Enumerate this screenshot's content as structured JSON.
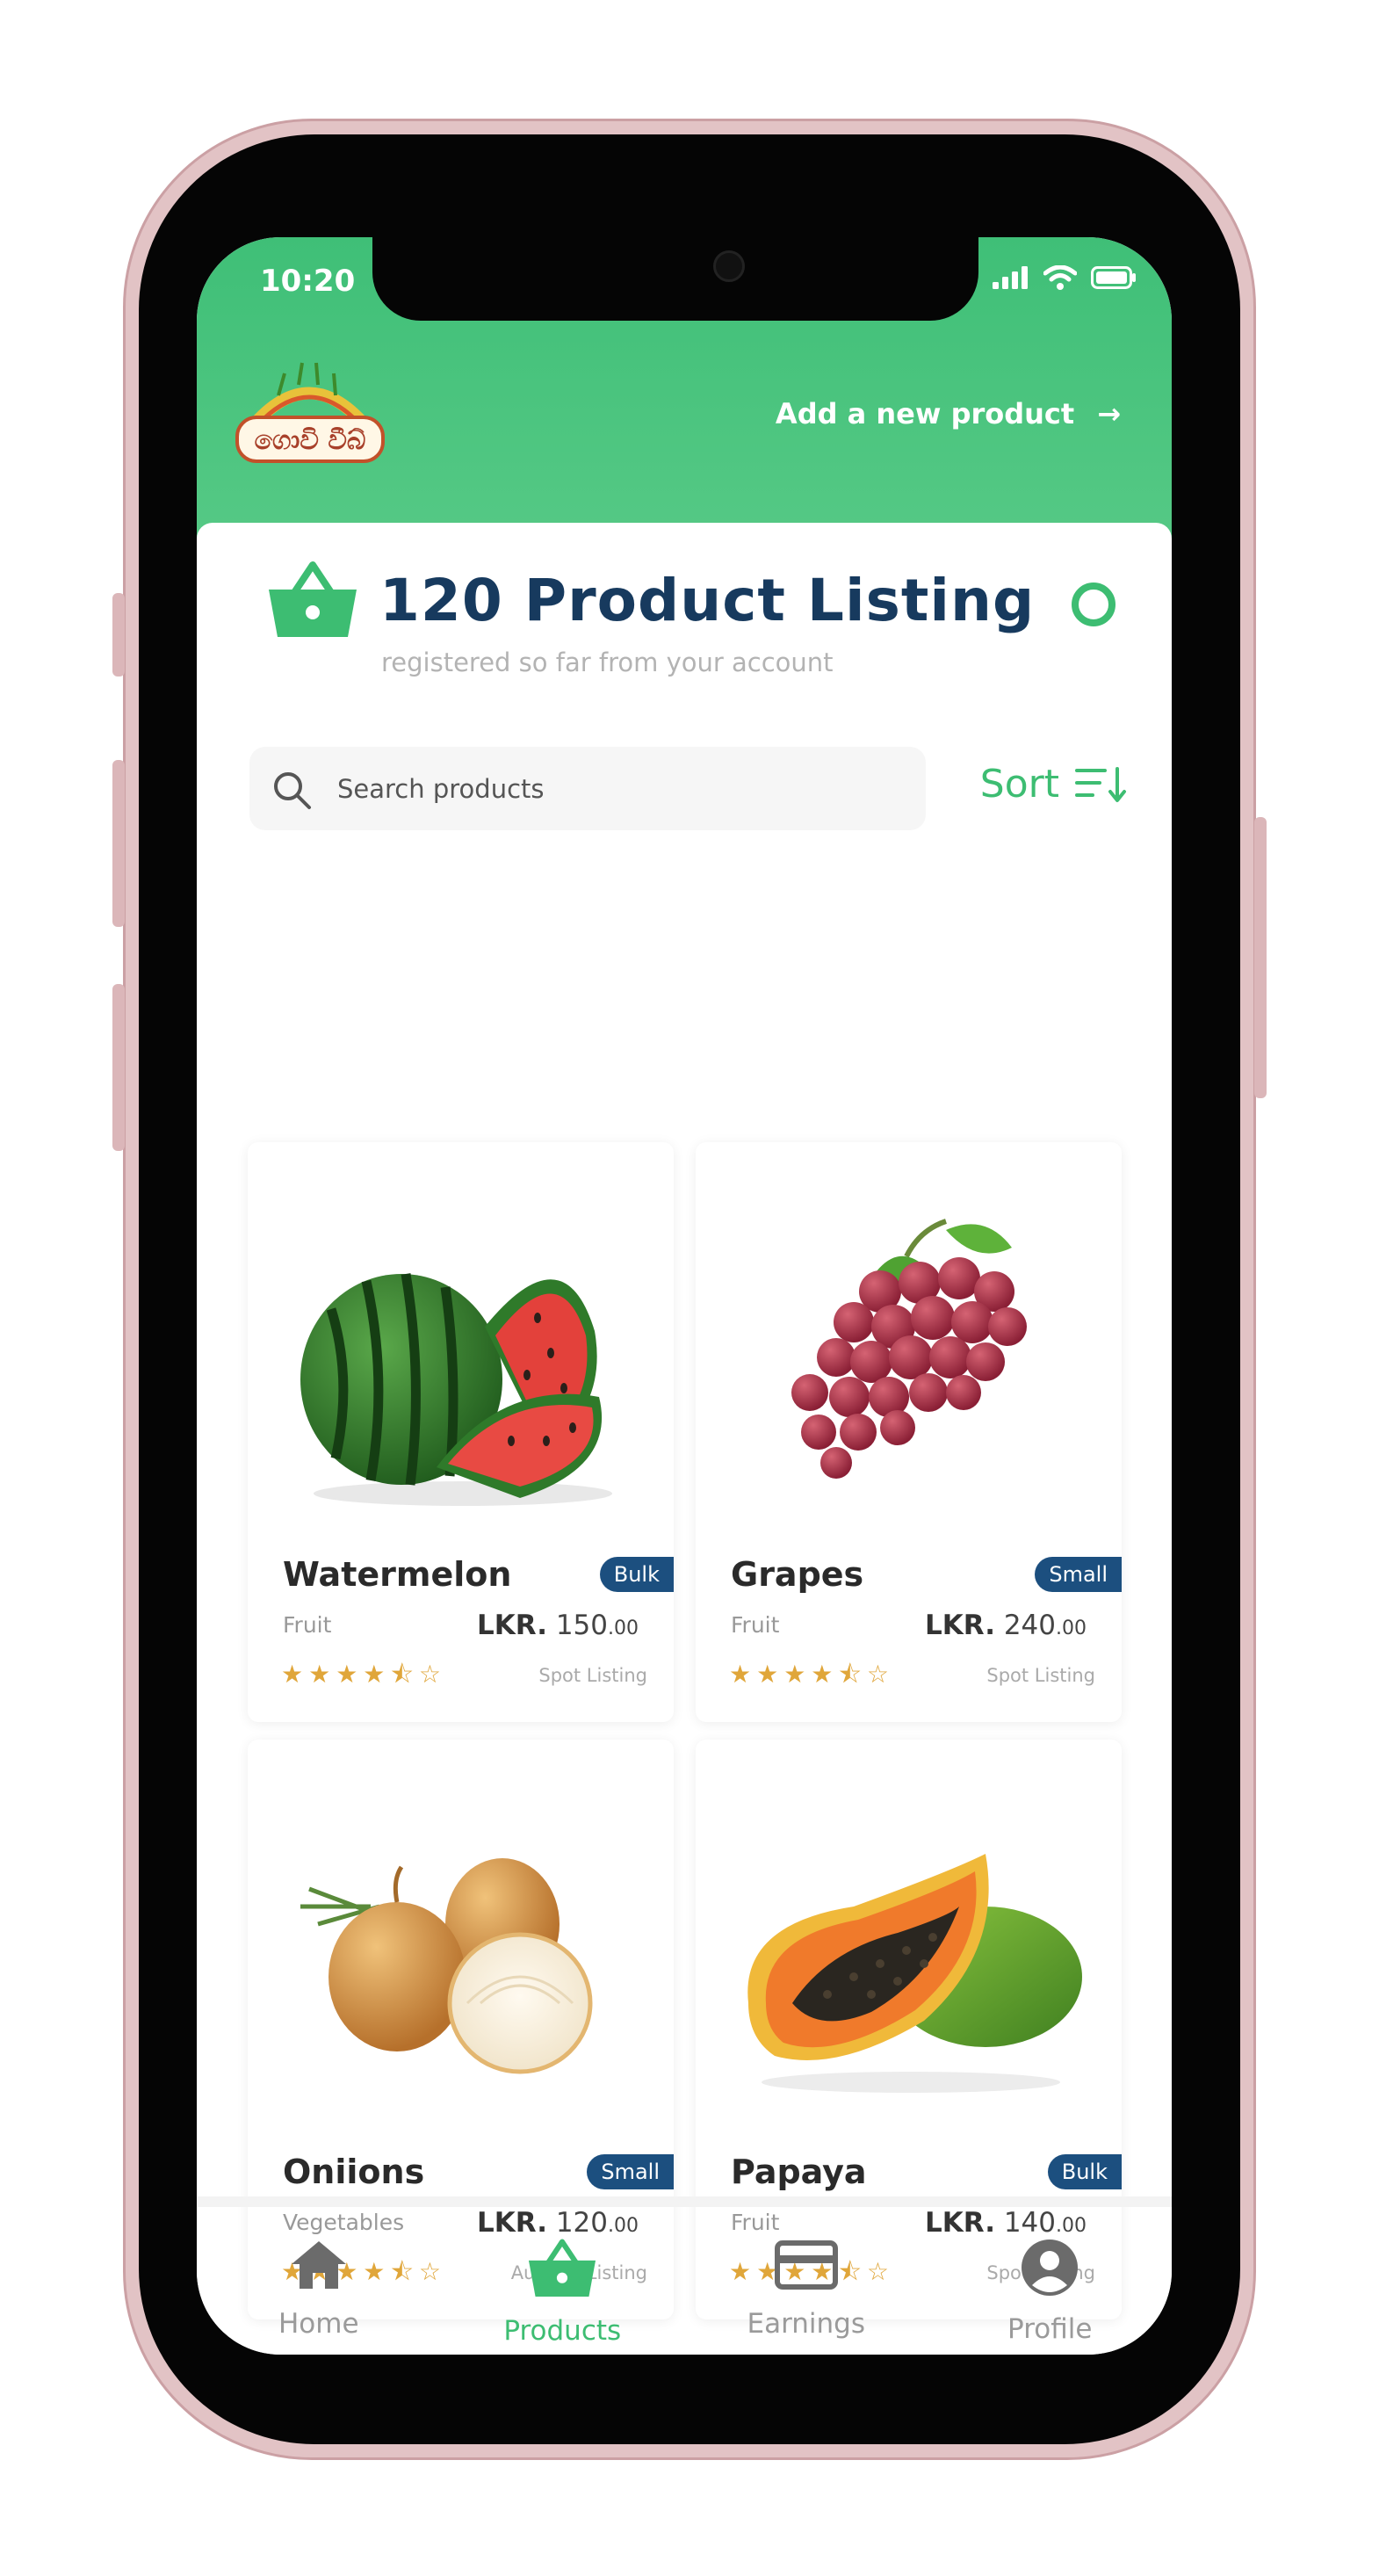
{
  "status_bar": {
    "time": "10:20"
  },
  "header": {
    "logo_text": "ගොවි වීබ්",
    "add_product_label": "Add a new product",
    "add_product_arrow": "→"
  },
  "summary": {
    "title": "120 Product Listing",
    "subtitle": "registered so far from your account"
  },
  "search": {
    "placeholder": "Search products"
  },
  "sort": {
    "label": "Sort"
  },
  "products": [
    {
      "name": "Watermelon",
      "badge": "Bulk",
      "category": "Fruit",
      "currency": "LKR.",
      "price": "150",
      "cents": ".00",
      "rating": 4.5,
      "listing_type": "Spot Listing"
    },
    {
      "name": "Grapes",
      "badge": "Small",
      "category": "Fruit",
      "currency": "LKR.",
      "price": "240",
      "cents": ".00",
      "rating": 4.5,
      "listing_type": "Spot Listing"
    },
    {
      "name": "Oniions",
      "badge": "Small",
      "category": "Vegetables",
      "currency": "LKR.",
      "price": "120",
      "cents": ".00",
      "rating": 4.5,
      "listing_type": "Auction Listing"
    },
    {
      "name": "Papaya",
      "badge": "Bulk",
      "category": "Fruit",
      "currency": "LKR.",
      "price": "140",
      "cents": ".00",
      "rating": 4.5,
      "listing_type": "Spot Listing"
    }
  ],
  "nav": {
    "items": [
      {
        "label": "Home",
        "icon": "home-icon",
        "active": false
      },
      {
        "label": "Products",
        "icon": "basket-icon",
        "active": true
      },
      {
        "label": "Earnings",
        "icon": "card-icon",
        "active": false
      },
      {
        "label": "Profile",
        "icon": "profile-icon",
        "active": false
      }
    ]
  },
  "colors": {
    "brand_green": "#3dbd72",
    "title_navy": "#173a5e",
    "badge_blue": "#1c4f7f",
    "star_orange": "#e0a63a"
  }
}
